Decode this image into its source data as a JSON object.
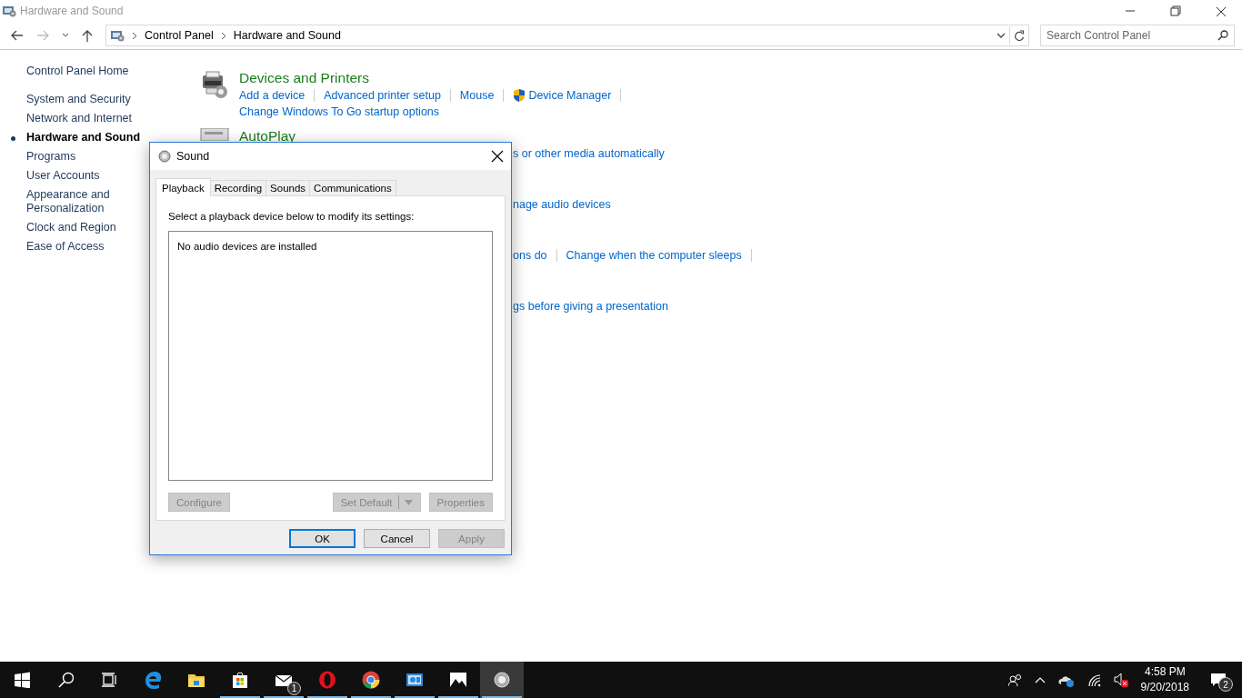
{
  "window": {
    "title": "Hardware and Sound"
  },
  "address_bar": {
    "breadcrumbs": [
      "Control Panel",
      "Hardware and Sound"
    ]
  },
  "search": {
    "placeholder": "Search Control Panel"
  },
  "sidebar": {
    "home": "Control Panel Home",
    "items": [
      {
        "label": "System and Security",
        "selected": false
      },
      {
        "label": "Network and Internet",
        "selected": false
      },
      {
        "label": "Hardware and Sound",
        "selected": true
      },
      {
        "label": "Programs",
        "selected": false
      },
      {
        "label": "User Accounts",
        "selected": false
      },
      {
        "label": "Appearance and Personalization",
        "selected": false
      },
      {
        "label": "Clock and Region",
        "selected": false
      },
      {
        "label": "Ease of Access",
        "selected": false
      }
    ]
  },
  "categories": [
    {
      "title": "Devices and Printers",
      "rows": [
        {
          "links": [
            {
              "label": "Add a device",
              "shield": false
            },
            {
              "label": "Advanced printer setup",
              "shield": false
            },
            {
              "label": "Mouse",
              "shield": false
            },
            {
              "label": "Device Manager",
              "shield": true
            }
          ]
        },
        {
          "links": [
            {
              "label": "Change Windows To Go startup options",
              "shield": false
            }
          ]
        }
      ]
    }
  ],
  "partly_hidden_categories": [
    {
      "title": "AutoPlay",
      "rows": [
        {
          "links": [
            {
              "label": "s or other media automatically",
              "shield": false
            }
          ]
        }
      ]
    },
    {
      "rows": [
        {
          "links": [
            {
              "label": "nage audio devices",
              "shield": false
            }
          ]
        }
      ]
    },
    {
      "rows": [
        {
          "links": [
            {
              "label": "ons do",
              "shield": false
            },
            {
              "label": "Change when the computer sleeps",
              "shield": false
            }
          ]
        }
      ]
    },
    {
      "rows": [
        {
          "links": [
            {
              "label": "gs before giving a presentation",
              "shield": false
            }
          ]
        }
      ]
    }
  ],
  "dialog": {
    "title": "Sound",
    "tabs": [
      {
        "label": "Playback",
        "selected": true
      },
      {
        "label": "Recording",
        "selected": false
      },
      {
        "label": "Sounds",
        "selected": false
      },
      {
        "label": "Communications",
        "selected": false
      }
    ],
    "instruction": "Select a playback device below to modify its settings:",
    "device_list": {
      "empty_text": "No audio devices are installed"
    },
    "buttons": [
      {
        "label": "Configure",
        "disabled": true,
        "kind": "plain"
      },
      {
        "label": "Set Default",
        "disabled": true,
        "kind": "split"
      },
      {
        "label": "Properties",
        "disabled": true,
        "kind": "plain"
      }
    ],
    "footer_buttons": [
      {
        "label": "OK",
        "disabled": false,
        "default": true
      },
      {
        "label": "Cancel",
        "disabled": false,
        "default": false
      },
      {
        "label": "Apply",
        "disabled": true,
        "default": false
      }
    ]
  },
  "taskbar": {
    "apps": [
      {
        "kind": "edge",
        "running": false,
        "active": false
      },
      {
        "kind": "explorer",
        "running": false,
        "active": false
      },
      {
        "kind": "store",
        "running": true,
        "active": false
      },
      {
        "kind": "mail",
        "running": true,
        "active": false,
        "badge": "1"
      },
      {
        "kind": "opera",
        "running": true,
        "active": false
      },
      {
        "kind": "chrome",
        "running": true,
        "active": false
      },
      {
        "kind": "control-panel",
        "running": true,
        "active": false
      },
      {
        "kind": "photos",
        "running": true,
        "active": false
      },
      {
        "kind": "sound",
        "running": true,
        "active": true
      }
    ],
    "time": "4:58 PM",
    "date": "9/20/2018",
    "notification_count": "2"
  }
}
